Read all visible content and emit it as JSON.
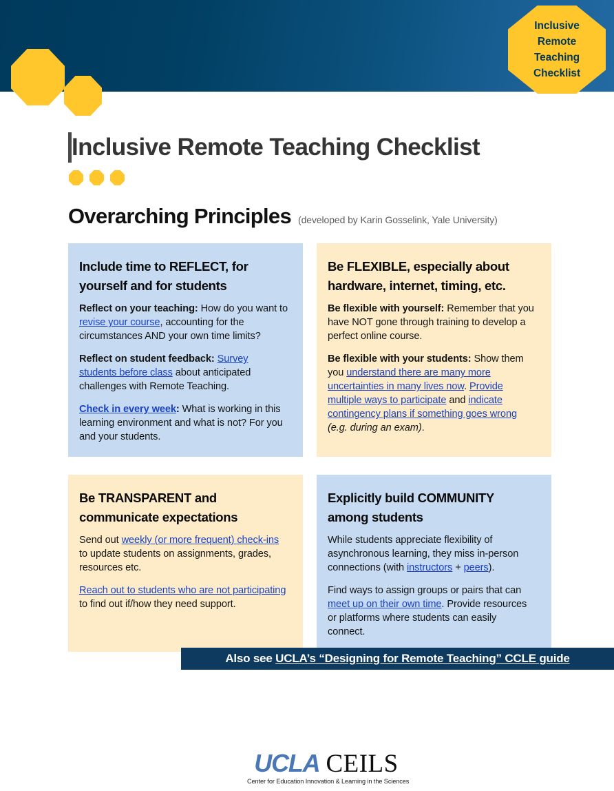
{
  "colors": {
    "header_left": "#00395c",
    "header_right": "#226aa2",
    "gold": "#ffc72c",
    "card_blue": "#c6daf1",
    "card_cream": "#fdecc7",
    "link_blue": "#1a42c4",
    "banner_navy": "#0f3a60",
    "logo_blue": "#4a77b5"
  },
  "header": {
    "badge_lines": [
      "Inclusive",
      "Remote",
      "Teaching",
      "Checklist"
    ],
    "decor_icons": [
      "octagon-icon",
      "octagon-icon"
    ]
  },
  "title": {
    "text": "Inclusive Remote Teaching Checklist",
    "dots": [
      "octagon-dot-icon",
      "octagon-dot-icon",
      "octagon-dot-icon"
    ]
  },
  "section": {
    "heading": "Overarching Principles",
    "attribution": "(developed by Karin Gosselink, Yale University)"
  },
  "cards": [
    {
      "id": "reflect",
      "theme": "blue",
      "title": "Include time to REFLECT, for yourself and for students",
      "paragraphs": [
        {
          "parts": [
            {
              "t": "Reflect on your teaching:",
              "style": "bold"
            },
            {
              "t": " How do you want to ",
              "style": "plain"
            },
            {
              "t": "revise your course",
              "style": "link"
            },
            {
              "t": ", accounting for the circumstances AND your own time limits?",
              "style": "plain"
            }
          ]
        },
        {
          "parts": [
            {
              "t": "Reflect on student feedback:",
              "style": "bold"
            },
            {
              "t": " ",
              "style": "plain"
            },
            {
              "t": "Survey students before class",
              "style": "link"
            },
            {
              "t": " about anticipated challenges with Remote Teaching.",
              "style": "plain"
            }
          ]
        },
        {
          "parts": [
            {
              "t": "Check in every week",
              "style": "link-bold"
            },
            {
              "t": ":",
              "style": "bold"
            },
            {
              "t": " What is working in this learning environment and what is not? For you and your students.",
              "style": "plain"
            }
          ]
        }
      ]
    },
    {
      "id": "flexible",
      "theme": "cream",
      "title": "Be FLEXIBLE, especially about hardware, internet, timing, etc.",
      "paragraphs": [
        {
          "parts": [
            {
              "t": "Be flexible with yourself:",
              "style": "bold"
            },
            {
              "t": " Remember that you have NOT gone through training to develop a perfect online course.",
              "style": "plain"
            }
          ]
        },
        {
          "parts": [
            {
              "t": "Be flexible with your students:",
              "style": "bold"
            },
            {
              "t": " Show them you ",
              "style": "plain"
            },
            {
              "t": "understand there are many more uncertainties in many lives now",
              "style": "link"
            },
            {
              "t": ". ",
              "style": "plain"
            },
            {
              "t": "Provide multiple ways to participate",
              "style": "link"
            },
            {
              "t": " and ",
              "style": "plain"
            },
            {
              "t": "indicate contingency plans if something goes wrong",
              "style": "link"
            },
            {
              "t": " ",
              "style": "plain"
            },
            {
              "t": "(e.g. during an exam)",
              "style": "italic"
            },
            {
              "t": ".",
              "style": "plain"
            }
          ]
        }
      ]
    },
    {
      "id": "transparent",
      "theme": "cream",
      "title": "Be TRANSPARENT and communicate expectations",
      "paragraphs": [
        {
          "parts": [
            {
              "t": "Send out ",
              "style": "plain"
            },
            {
              "t": "weekly (or more frequent) check-ins",
              "style": "link"
            },
            {
              "t": " to update students on assignments, grades, resources etc.",
              "style": "plain"
            }
          ]
        },
        {
          "parts": [
            {
              "t": "Reach out to students who are not participating",
              "style": "link"
            },
            {
              "t": " to find out if/how they need support.",
              "style": "plain"
            }
          ]
        }
      ]
    },
    {
      "id": "community",
      "theme": "blue",
      "title": "Explicitly build COMMUNITY among students",
      "paragraphs": [
        {
          "parts": [
            {
              "t": "While students appreciate flexibility of asynchronous learning, they miss in-person connections (with ",
              "style": "plain"
            },
            {
              "t": "instructors",
              "style": "link"
            },
            {
              "t": " + ",
              "style": "plain"
            },
            {
              "t": "peers",
              "style": "link"
            },
            {
              "t": ").",
              "style": "plain"
            }
          ]
        },
        {
          "parts": [
            {
              "t": "Find ways to assign groups or pairs that can ",
              "style": "plain"
            },
            {
              "t": "meet up on their own time",
              "style": "link"
            },
            {
              "t": ". Provide resources or platforms where students can easily connect.",
              "style": "plain"
            }
          ]
        }
      ]
    }
  ],
  "banner": {
    "prefix": "Also see ",
    "link": "UCLA’s “Designing for Remote Teaching” CCLE guide"
  },
  "logo": {
    "ucla": "UCLA",
    "ceils": "CEILS",
    "tagline": "Center for Education Innovation & Learning in the Sciences"
  }
}
